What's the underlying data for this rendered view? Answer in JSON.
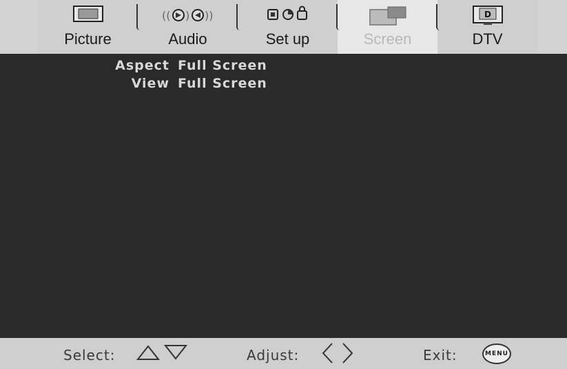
{
  "tabs": [
    {
      "label": "Picture",
      "icon": "tv-icon",
      "active": false
    },
    {
      "label": "Audio",
      "icon": "speaker-icon",
      "active": false
    },
    {
      "label": "Set up",
      "icon": "setup-icon",
      "active": false
    },
    {
      "label": "Screen",
      "icon": "screen-icon",
      "active": true
    },
    {
      "label": "DTV",
      "icon": "dtv-icon",
      "active": false
    }
  ],
  "dtv_icon_letter": "D",
  "settings": [
    {
      "label": "Aspect",
      "value": "Full Screen"
    },
    {
      "label": "View",
      "value": "Full Screen"
    }
  ],
  "footer": {
    "select_label": "Select:",
    "adjust_label": "Adjust:",
    "exit_label": "Exit:",
    "menu_badge": "MENU"
  },
  "colors": {
    "content_bg": "#2a2a2a",
    "bar_bg": "#cfcfcf",
    "active_tab_text": "#b9b9b9"
  }
}
